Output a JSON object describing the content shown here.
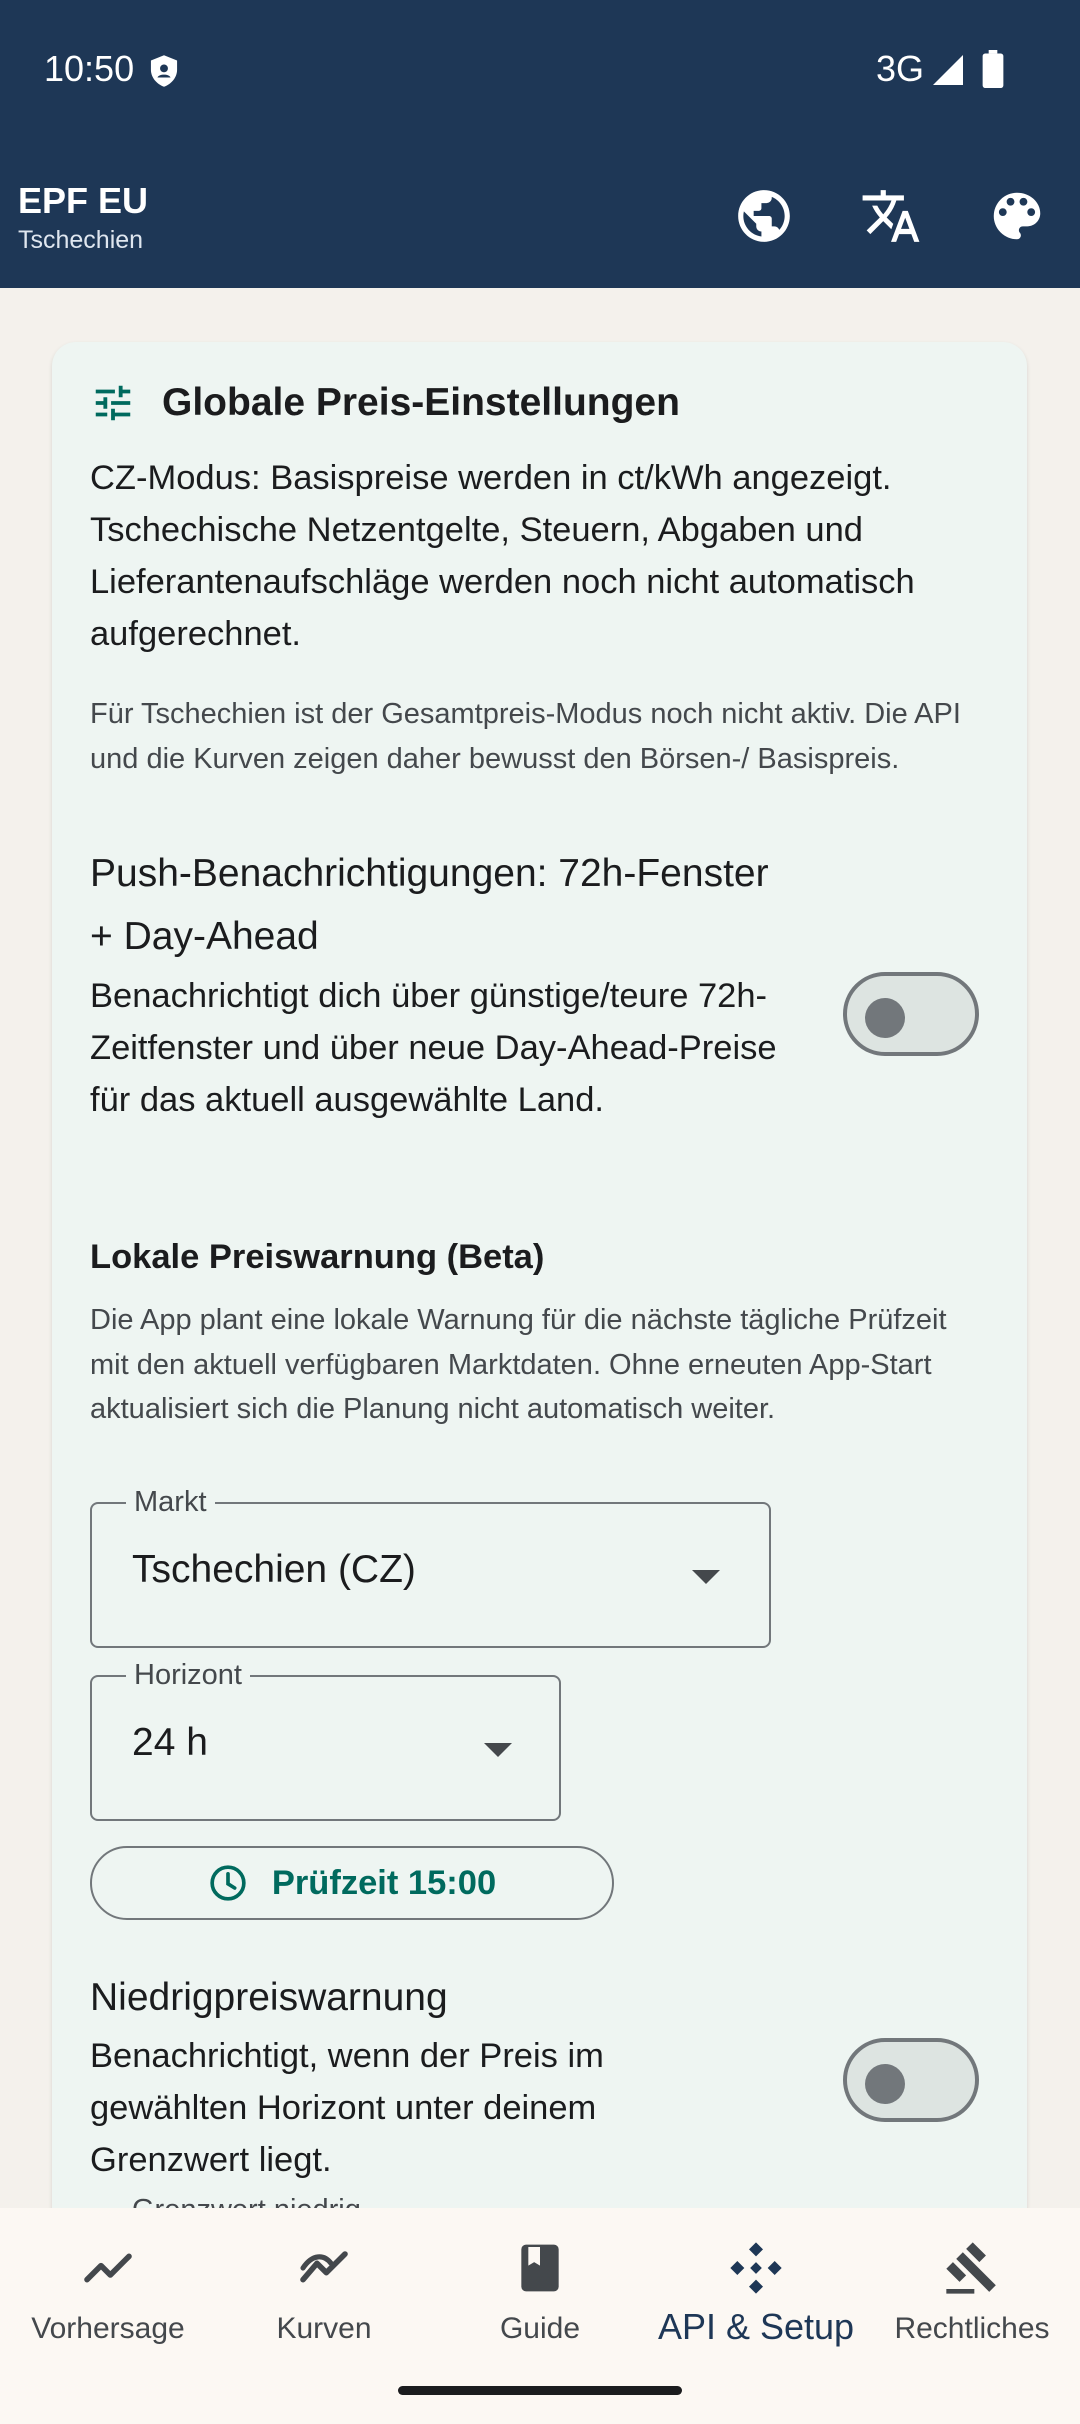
{
  "status_bar": {
    "time": "10:50",
    "network": "3G"
  },
  "app_bar": {
    "title": "EPF EU",
    "subtitle": "Tschechien",
    "icons": [
      "globe-icon",
      "translate-icon",
      "palette-icon"
    ]
  },
  "card": {
    "title": "Globale Preis-Einstellungen",
    "mode_text": "CZ-Modus: Basispreise werden in ct/kWh angezeigt. Tschechische Netzentgelte, Steuern, Abgaben und Lieferantenaufschläge werden noch nicht automatisch aufgerechnet.",
    "mode_note": "Für Tschechien ist der Gesamtpreis-Modus noch nicht aktiv. Die API und die Kurven zeigen daher bewusst den Börsen-/ Basispreis.",
    "push": {
      "title": "Push-Benachrichtigungen: 72h-Fenster + Day-Ahead",
      "description": "Benachrichtigt dich über günstige/teure 72h-Zeitfenster und über neue Day-Ahead-Preise für das aktuell ausgewählte Land.",
      "enabled": false
    },
    "local_warning": {
      "title": "Lokale Preiswarnung (Beta)",
      "description": "Die App plant eine lokale Warnung für die nächste tägliche Prüfzeit mit den aktuell verfügbaren Marktdaten. Ohne erneuten App-Start aktualisiert sich die Planung nicht automatisch weiter.",
      "market_label": "Markt",
      "market_value": "Tschechien (CZ)",
      "horizon_label": "Horizont",
      "horizon_value": "24 h",
      "check_time_button": "Prüfzeit 15:00"
    },
    "low_price": {
      "title": "Niedrigpreiswarnung",
      "description": "Benachrichtigt, wenn der Preis im gewählten Horizont unter deinem Grenzwert liegt.",
      "enabled": false,
      "cut_off_label": "Grenzwert niedrig"
    }
  },
  "bottom_nav": {
    "items": [
      {
        "label": "Vorhersage",
        "icon": "trend-icon",
        "active": false
      },
      {
        "label": "Kurven",
        "icon": "curve-icon",
        "active": false
      },
      {
        "label": "Guide",
        "icon": "book-icon",
        "active": false
      },
      {
        "label": "API & Setup",
        "icon": "api-icon",
        "active": true
      },
      {
        "label": "Rechtliches",
        "icon": "gavel-icon",
        "active": false
      }
    ]
  },
  "colors": {
    "header": "#1e3756",
    "accent": "#006a5e",
    "card": "#eef5f2",
    "background": "#f4f1ec"
  }
}
